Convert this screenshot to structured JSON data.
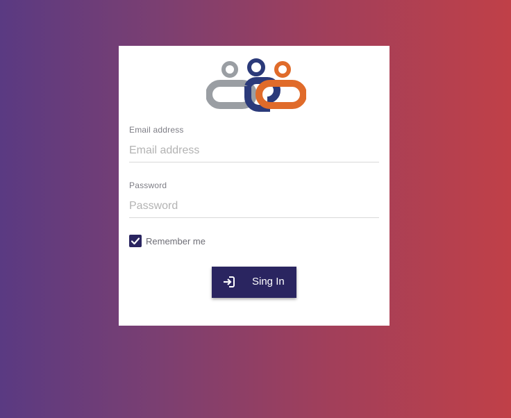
{
  "login": {
    "logo_icon": "linked-people-logo",
    "logo_colors": [
      "#9a9ea3",
      "#2b3a7a",
      "#e06b2a"
    ],
    "email": {
      "label": "Email address",
      "placeholder": "Email address",
      "value": ""
    },
    "password": {
      "label": "Password",
      "placeholder": "Password",
      "value": ""
    },
    "remember": {
      "label": "Remember me",
      "checked": true
    },
    "signin": {
      "label": "Sing In",
      "icon": "sign-in-icon"
    }
  },
  "colors": {
    "primary": "#2a2560",
    "gradient_start": "#5a3a82",
    "gradient_end": "#c04048"
  }
}
